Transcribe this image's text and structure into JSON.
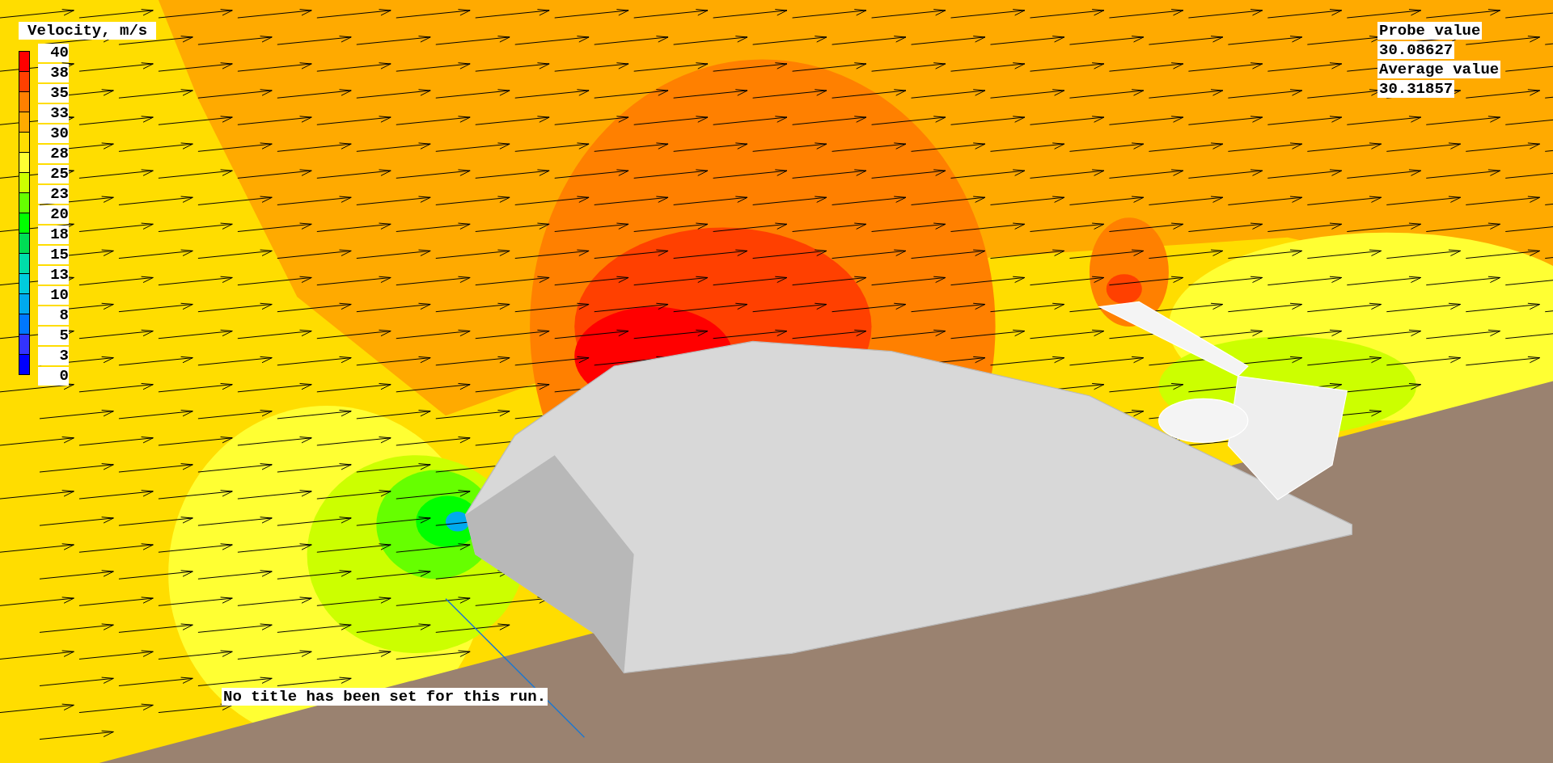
{
  "legend": {
    "title": "Velocity, m/s",
    "labels": [
      "40",
      "38",
      "35",
      "33",
      "30",
      "28",
      "25",
      "23",
      "20",
      "18",
      "15",
      "13",
      "10",
      "8",
      "5",
      "3",
      "0"
    ],
    "bands": [
      {
        "color": "#ff0000"
      },
      {
        "color": "#ff4000"
      },
      {
        "color": "#ff8000"
      },
      {
        "color": "#ffaa00"
      },
      {
        "color": "#ffdd00"
      },
      {
        "color": "#ffff33"
      },
      {
        "color": "#ccff00"
      },
      {
        "color": "#66ff00"
      },
      {
        "color": "#00ff00"
      },
      {
        "color": "#00dd55"
      },
      {
        "color": "#00ddaa"
      },
      {
        "color": "#00ccdd"
      },
      {
        "color": "#00aaee"
      },
      {
        "color": "#0077ff"
      },
      {
        "color": "#3333ff"
      },
      {
        "color": "#0000ff"
      }
    ]
  },
  "probe": {
    "probe_label": "Probe value",
    "probe_value": "30.08627",
    "average_label": "Average value",
    "average_value": "30.31857"
  },
  "run_title": "No title has been set for this run."
}
